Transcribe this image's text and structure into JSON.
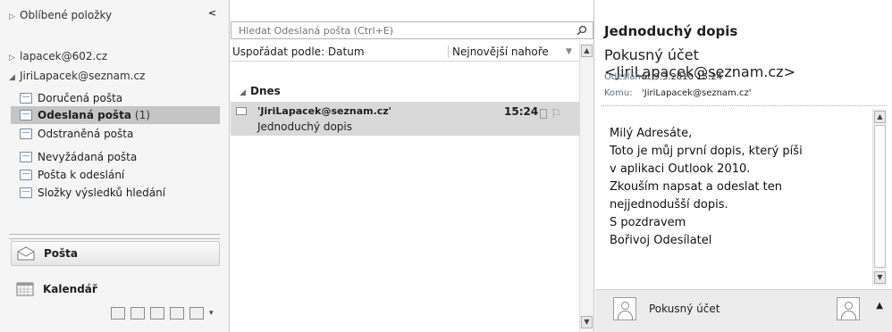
{
  "nav": {
    "favorites_label": "Oblíbené položky",
    "collapse_glyph": "<",
    "accounts": [
      "lapacek@602.cz",
      "JiriLapacek@seznam.cz"
    ],
    "folders": [
      {
        "label": "Doručená pošta",
        "count": ""
      },
      {
        "label": "Odeslaná pošta",
        "count": "(1)"
      },
      {
        "label": "Odstraněná pošta",
        "count": ""
      },
      {
        "label": "Nevyžádaná pošta",
        "count": ""
      },
      {
        "label": "Pošta k odeslání",
        "count": ""
      },
      {
        "label": "Složky výsledků hledání",
        "count": ""
      }
    ],
    "modules": {
      "mail": "Pošta",
      "calendar": "Kalendář"
    }
  },
  "list": {
    "search_placeholder": "Hledat Odeslaná pošta (Ctrl+E)",
    "sort_by": "Uspořádat podle: Datum",
    "sort_order": "Nejnovější nahoře",
    "group_label": "Dnes",
    "messages": [
      {
        "from": "'JiriLapacek@seznam.cz'",
        "time": "15:24",
        "subject": "Jednoduchý dopis"
      }
    ]
  },
  "reading": {
    "subject": "Jednoduchý dopis",
    "from": "Pokusný účet <JiriLapacek@seznam.cz>",
    "sent_label": "Odesláno:",
    "sent_value": "út 9.3.2010 15:24",
    "to_label": "Komu:",
    "to_value": "'JiriLapacek@seznam.cz'",
    "body": [
      "Milý Adresáte,",
      "Toto je můj první dopis, který píši",
      "v aplikaci Outlook 2010.",
      "Zkouším napsat a odeslat ten",
      "nejjednodušší dopis.",
      "S pozdravem",
      "Bořivoj Odesílatel"
    ],
    "people_name": "Pokusný účet"
  },
  "colors": {
    "selection": "#d9d9d9",
    "selected_folder": "#c5c5c5"
  }
}
